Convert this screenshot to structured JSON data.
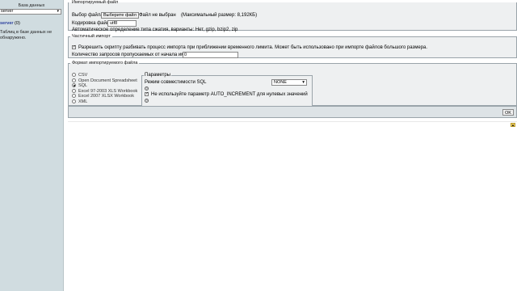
{
  "sidebar": {
    "db_label": "База данных",
    "db_selected": "server",
    "server_name": "server",
    "server_count": " (0)",
    "note": "Таблиц в базе данных не обнаружено."
  },
  "import_file": {
    "legend": "Импортируемый файл",
    "choose_label": "Выбор файла",
    "choose_button": "Выберите файл",
    "no_file": "Файл не выбран",
    "max_size": "(Максимальный размер: 8,192КБ)",
    "encoding_label": "Кодировка файла:",
    "encoding_value": "utf8",
    "compression_note": "Автоматическое определение типа сжатия, варианты: Нет, gzip, bzip2, zip"
  },
  "partial_import": {
    "legend": "Частичный импорт",
    "allow_interrupt": "Разрешить скрипту разбивать процесс импорта при приближении временного лимита. Может быть использовано при импорте файлов большого размера.",
    "skip_label": "Количество запросов пропускаемых от начала импорта",
    "skip_value": "0"
  },
  "format": {
    "legend": "Формат импортируемого файла",
    "options": [
      "CSV",
      "Open Document Spreadsheet",
      "SQL",
      "Excel 97-2003 XLS Workbook",
      "Excel 2007 XLSX Workbook",
      "XML"
    ],
    "selected": "SQL",
    "params_legend": "Параметры",
    "compat_label": "Режим совместимости SQL",
    "compat_value": "NONE",
    "no_auto_inc": "Не используйте параметр AUTO_INCREMENT для нулевых значений"
  },
  "footer": {
    "ok": "OK"
  }
}
